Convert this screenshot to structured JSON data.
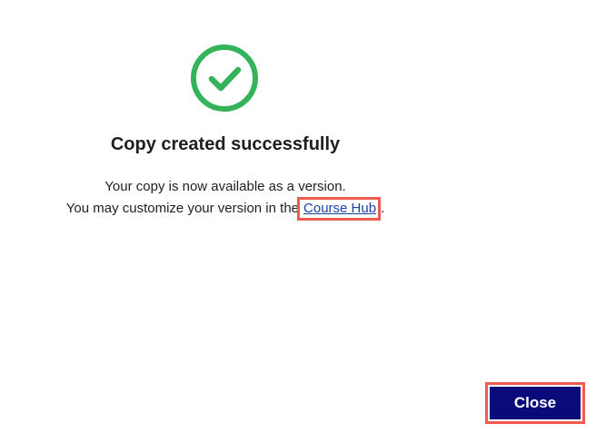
{
  "dialog": {
    "icon": "check-circle-icon",
    "title": "Copy created successfully",
    "message_line1": "Your copy is now available as a version.",
    "message_line2_prefix": "You may customize your version in the",
    "link_label": "Course Hub",
    "message_line2_suffix": ".",
    "close_label": "Close"
  },
  "colors": {
    "success": "#34b35a",
    "primary_button": "#0b0a7a",
    "link": "#1a43a8",
    "highlight": "#ef5b50"
  }
}
